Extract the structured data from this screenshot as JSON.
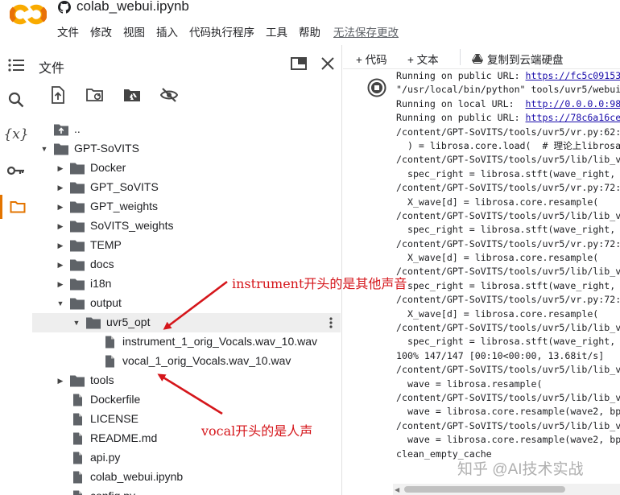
{
  "header": {
    "title": "colab_webui.ipynb",
    "menu": [
      "文件",
      "修改",
      "视图",
      "插入",
      "代码执行程序",
      "工具",
      "帮助"
    ],
    "unsaved": "无法保存更改"
  },
  "rail": {
    "icons": [
      "toc-icon",
      "search-icon",
      "variables-icon",
      "key-icon",
      "folder-icon"
    ],
    "variables_glyph": "{x}"
  },
  "panel": {
    "title": "文件",
    "tree": [
      {
        "label": "..",
        "depth": 0,
        "type": "folder-up"
      },
      {
        "label": "GPT-SoVITS",
        "depth": 0,
        "type": "folder",
        "open": true
      },
      {
        "label": "Docker",
        "depth": 1,
        "type": "folder"
      },
      {
        "label": "GPT_SoVITS",
        "depth": 1,
        "type": "folder"
      },
      {
        "label": "GPT_weights",
        "depth": 1,
        "type": "folder"
      },
      {
        "label": "SoVITS_weights",
        "depth": 1,
        "type": "folder"
      },
      {
        "label": "TEMP",
        "depth": 1,
        "type": "folder"
      },
      {
        "label": "docs",
        "depth": 1,
        "type": "folder"
      },
      {
        "label": "i18n",
        "depth": 1,
        "type": "folder"
      },
      {
        "label": "output",
        "depth": 1,
        "type": "folder",
        "open": true
      },
      {
        "label": "uvr5_opt",
        "depth": 2,
        "type": "folder",
        "open": true,
        "selected": true
      },
      {
        "label": "instrument_1_orig_Vocals.wav_10.wav",
        "depth": 3,
        "type": "file"
      },
      {
        "label": "vocal_1_orig_Vocals.wav_10.wav",
        "depth": 3,
        "type": "file"
      },
      {
        "label": "tools",
        "depth": 1,
        "type": "folder"
      },
      {
        "label": "Dockerfile",
        "depth": 1,
        "type": "file"
      },
      {
        "label": "LICENSE",
        "depth": 1,
        "type": "file"
      },
      {
        "label": "README.md",
        "depth": 1,
        "type": "file"
      },
      {
        "label": "api.py",
        "depth": 1,
        "type": "file"
      },
      {
        "label": "colab_webui.ipynb",
        "depth": 1,
        "type": "file"
      },
      {
        "label": "config.py",
        "depth": 1,
        "type": "file"
      }
    ]
  },
  "code_toolbar": {
    "add_code": "+ 代码",
    "add_text": "+ 文本",
    "copy_drive": "复制到云端硬盘"
  },
  "output_lines": [
    {
      "text": "Running on public URL: ",
      "link": "https://fc5c09153"
    },
    {
      "text": "\"/usr/local/bin/python\" tools/uvr5/webui"
    },
    {
      "text": "Running on local URL:  ",
      "link": "http://0.0.0.0:98"
    },
    {
      "text": "Running on public URL: ",
      "link": "https://78c6a16ce"
    },
    {
      "text": "/content/GPT-SoVITS/tools/uvr5/vr.py:62:"
    },
    {
      "text": "  ) = librosa.core.load(  # 理论上librosa"
    },
    {
      "text": "/content/GPT-SoVITS/tools/uvr5/lib/lib_v"
    },
    {
      "text": "  spec_right = librosa.stft(wave_right, "
    },
    {
      "text": "/content/GPT-SoVITS/tools/uvr5/vr.py:72:"
    },
    {
      "text": "  X_wave[d] = librosa.core.resample("
    },
    {
      "text": "/content/GPT-SoVITS/tools/uvr5/lib/lib_v"
    },
    {
      "text": "  spec_right = librosa.stft(wave_right, "
    },
    {
      "text": "/content/GPT-SoVITS/tools/uvr5/vr.py:72:"
    },
    {
      "text": "  X_wave[d] = librosa.core.resample("
    },
    {
      "text": "/content/GPT-SoVITS/tools/uvr5/lib/lib_v"
    },
    {
      "text": "  spec_right = librosa.stft(wave_right, "
    },
    {
      "text": "/content/GPT-SoVITS/tools/uvr5/vr.py:72:"
    },
    {
      "text": "  X_wave[d] = librosa.core.resample("
    },
    {
      "text": "/content/GPT-SoVITS/tools/uvr5/lib/lib_v"
    },
    {
      "text": "  spec_right = librosa.stft(wave_right, "
    },
    {
      "text": "100% 147/147 [00:10<00:00, 13.68it/s]"
    },
    {
      "text": "/content/GPT-SoVITS/tools/uvr5/lib/lib_v"
    },
    {
      "text": "  wave = librosa.resample("
    },
    {
      "text": "/content/GPT-SoVITS/tools/uvr5/lib/lib_v"
    },
    {
      "text": "  wave = librosa.core.resample(wave2, bp"
    },
    {
      "text": "/content/GPT-SoVITS/tools/uvr5/lib/lib_v"
    },
    {
      "text": "  wave = librosa.core.resample(wave2, bp"
    },
    {
      "text": "clean_empty_cache"
    }
  ],
  "annotations": {
    "instrument": "instrument开头的是其他声音",
    "vocal": "vocal开头的是人声"
  },
  "watermark": "知乎 @AI技术实战",
  "colors": {
    "accent": "#e37400",
    "annotation": "#d5161b",
    "link": "#1a0dab",
    "folder": "#5f6368"
  }
}
